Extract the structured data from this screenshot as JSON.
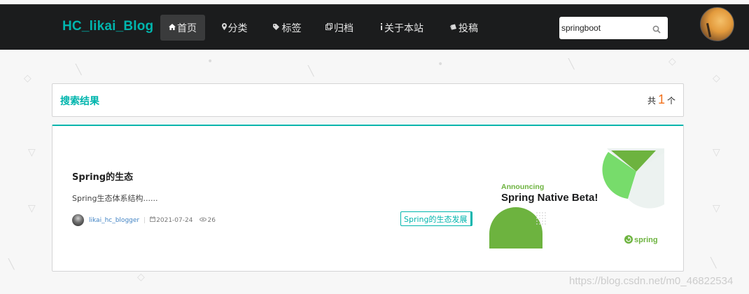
{
  "brand": {
    "name": "HC_likai_Blog"
  },
  "nav": {
    "items": [
      {
        "label": "首页",
        "icon": "home-icon",
        "active": true
      },
      {
        "label": "分类",
        "icon": "map-pin-icon",
        "active": false
      },
      {
        "label": "标签",
        "icon": "tags-icon",
        "active": false
      },
      {
        "label": "归档",
        "icon": "clone-icon",
        "active": false
      },
      {
        "label": "关于本站",
        "icon": "info-icon",
        "active": false
      },
      {
        "label": "投稿",
        "icon": "book-icon",
        "active": false
      }
    ]
  },
  "search": {
    "value": "springboot",
    "icon": "search-icon"
  },
  "results": {
    "title": "搜索结果",
    "count_prefix": "共",
    "count": "1",
    "count_suffix": "个"
  },
  "post": {
    "title": "Spring的生态",
    "excerpt": "Spring生态体系结构......",
    "author": "likai_hc_blogger",
    "date": "2021-07-24",
    "views": "26",
    "tag": "Spring的生态发展",
    "thumbnail": {
      "headline_small": "Announcing",
      "headline_large": "Spring Native Beta!",
      "logo_text": "spring"
    }
  },
  "watermark": "https://blog.csdn.net/m0_46822534",
  "colors": {
    "accent": "#00b5ad",
    "navbar": "#1b1c1d",
    "count": "#f2711c",
    "spring_green": "#6db33f"
  }
}
